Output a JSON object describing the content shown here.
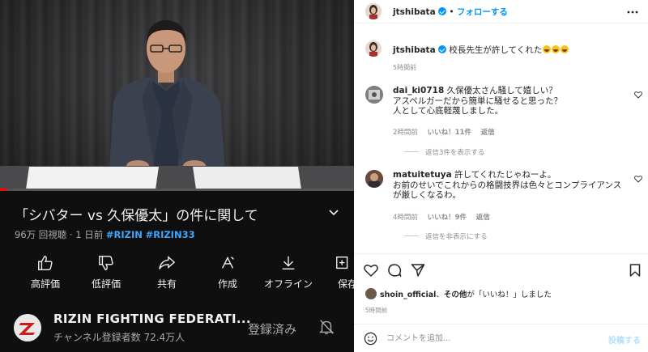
{
  "video": {
    "progress_fraction": 0.02,
    "title": "「シバター vs 久保優太」の件に関して",
    "views": "96万 回視聴",
    "age": "1 日前",
    "hashtags": [
      "#RIZIN",
      "#RIZIN33"
    ],
    "actions": [
      {
        "label": "高評価",
        "icon": "thumbs-up-icon"
      },
      {
        "label": "低評価",
        "icon": "thumbs-down-icon"
      },
      {
        "label": "共有",
        "icon": "share-icon"
      },
      {
        "label": "作成",
        "icon": "remix-icon"
      },
      {
        "label": "オフライン",
        "icon": "download-icon"
      },
      {
        "label": "保存",
        "icon": "save-icon"
      }
    ]
  },
  "channel": {
    "name": "RIZIN FIGHTING FEDERATI...",
    "subscribers": "チャンネル登録者数 72.4万人",
    "subscribe_state": "登録済み"
  },
  "post": {
    "author": "jtshibata",
    "follow_label": "フォローする",
    "separator": "•",
    "caption": "校長先生が許してくれた",
    "caption_time": "5時間前",
    "comments": [
      {
        "user": "dai_ki0718",
        "lines": [
          "久保優太さん騒して嬉しい？",
          "アスペルガーだから簡単に騒せると思った？",
          "人として心底軽蔑しました。"
        ],
        "time": "2時間前",
        "likes": "いいね！11件",
        "reply": "返信",
        "replies_toggle": "返信3件を表示する"
      },
      {
        "user": "matuitetuya",
        "lines": [
          "許してくれたじゃねーよ。",
          "お前のせいでこれからの格闘技界は色々とコンプライアンス",
          "が厳しくなるわ。"
        ],
        "time": "4時間前",
        "likes": "いいね！9件",
        "reply": "返信",
        "replies_toggle": "返信を非表示にする"
      }
    ],
    "likes_user": "shoin_official",
    "likes_others": "その他",
    "likes_suffix": "が「いいね！」しました",
    "likes_prefix": "、",
    "time": "5時間前",
    "comment_placeholder": "コメントを追加...",
    "post_label": "投稿する"
  },
  "colors": {
    "progress": "#ff0000",
    "hashtag": "#3ea6ff",
    "follow": "#0095f6",
    "post_button_disabled": "#b2dffc"
  }
}
